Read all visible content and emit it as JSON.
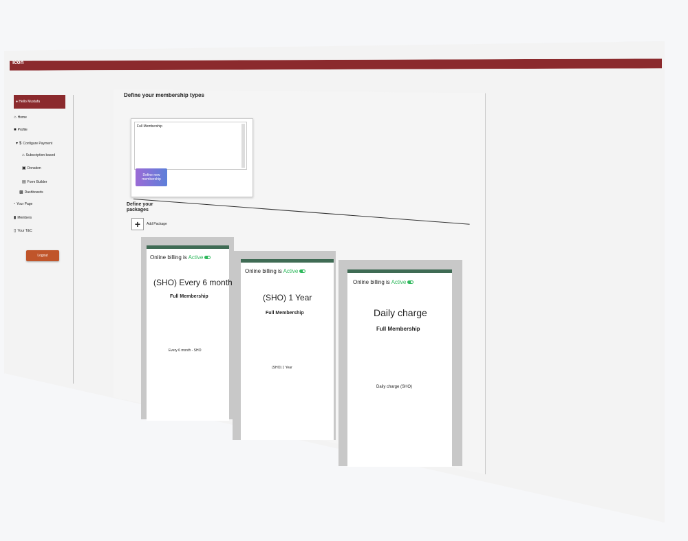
{
  "app": {
    "brand": "icon"
  },
  "sidebar": {
    "user": "Hello Mustafa",
    "items": [
      {
        "label": "Home",
        "icon": "home-icon"
      },
      {
        "label": "Profile",
        "icon": "user-icon"
      },
      {
        "label": "Configure Payment",
        "icon": "dollar-icon"
      },
      {
        "label": "Subscription based",
        "icon": "home-icon"
      },
      {
        "label": "Donation",
        "icon": "card-icon"
      },
      {
        "label": "Form Builder",
        "icon": "form-icon"
      },
      {
        "label": "Dashboards",
        "icon": "chart-icon"
      },
      {
        "label": "Your Page",
        "icon": "page-icon"
      },
      {
        "label": "Members",
        "icon": "members-icon"
      },
      {
        "label": "Your T&C",
        "icon": "doc-icon"
      }
    ],
    "logout": "Logout"
  },
  "membership": {
    "heading": "Define your membership types",
    "list": [
      "Full Membership"
    ],
    "define_button": "Define new membership"
  },
  "packages": {
    "heading": "Define your packages",
    "add_label": "Add Package",
    "cards": [
      {
        "billing_prefix": "Online billing is",
        "billing_status": "Active",
        "title": "(SHO) Every 6 month",
        "subtitle": "Full Membership",
        "desc": "Every 6 month - SHO"
      },
      {
        "billing_prefix": "Online billing is",
        "billing_status": "Active",
        "title": "(SHO) 1 Year",
        "subtitle": "Full Membership",
        "desc": "(SHO) 1 Year"
      },
      {
        "billing_prefix": "Online billing is",
        "billing_status": "Active",
        "title": "Daily charge",
        "subtitle": "Full Membership",
        "desc": "Daily charge (SHO)"
      }
    ]
  }
}
